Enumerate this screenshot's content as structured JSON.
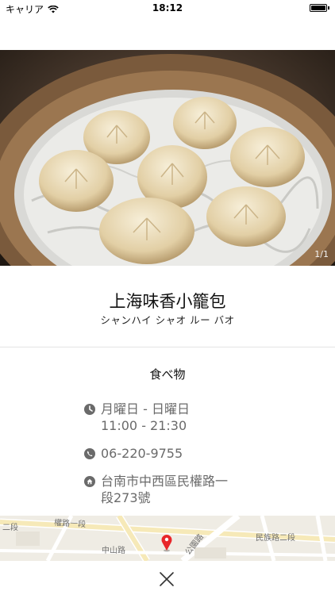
{
  "status_bar": {
    "carrier": "キャリア",
    "time": "18:12"
  },
  "photo": {
    "counter": "1/1"
  },
  "restaurant": {
    "name": "上海味香小籠包",
    "reading": "シャンハイ シャオ ルー バオ",
    "category": "食べ物",
    "hours": {
      "days": "月曜日 - 日曜日",
      "time": "11:00 - 21:30"
    },
    "phone": "06-220-9755",
    "address": {
      "line1": "台南市中西區民權路一",
      "line2": "段273號"
    }
  },
  "map": {
    "street_labels": [
      "權路一段",
      "中山路",
      "民族路二段",
      "二段",
      "公園路"
    ]
  },
  "icons": {
    "clock": "clock-icon",
    "phone": "phone-icon",
    "home": "home-icon",
    "close": "close-icon",
    "pin": "map-pin-icon"
  },
  "colors": {
    "info_text": "#6a6a6a",
    "pin": "#e8262a"
  }
}
